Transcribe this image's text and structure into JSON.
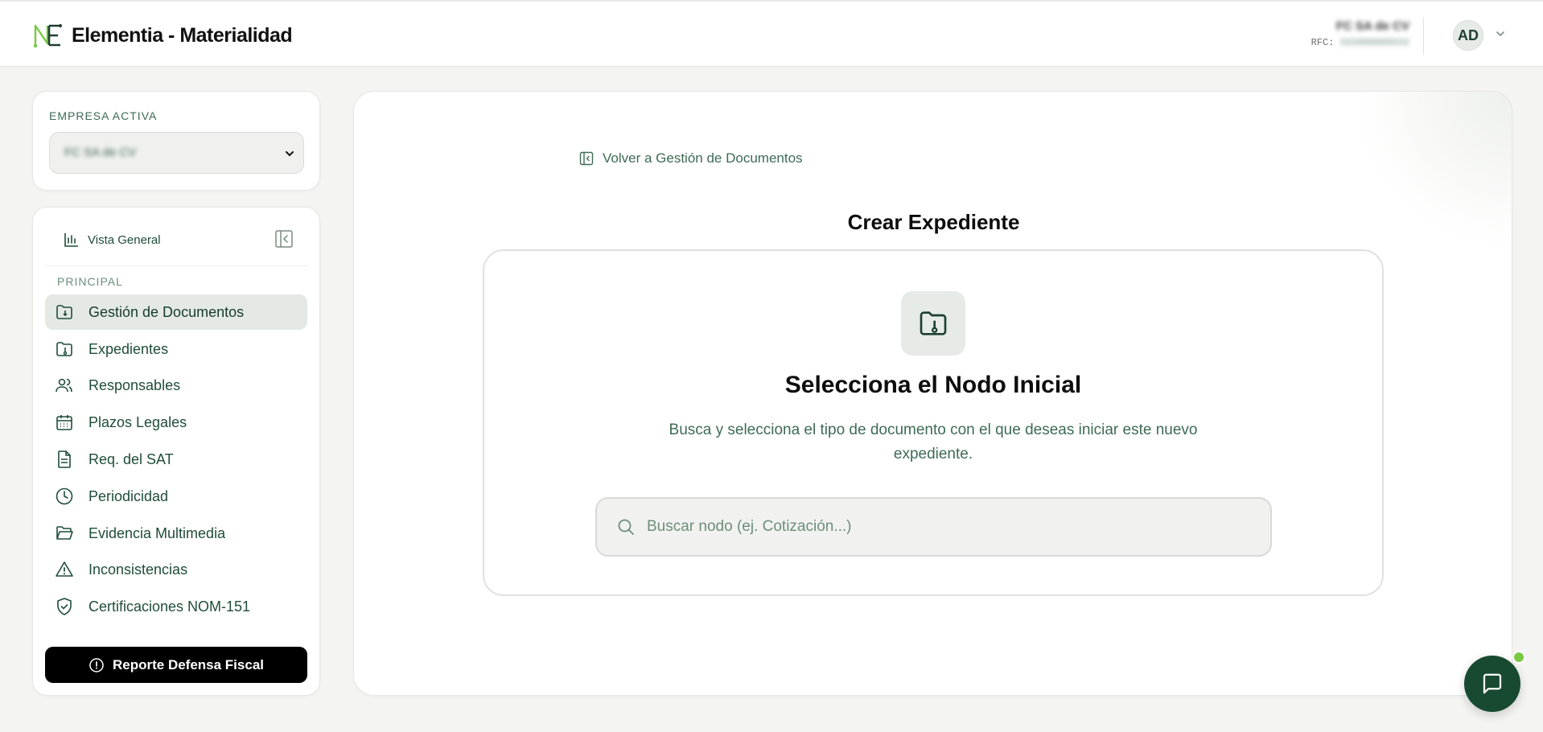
{
  "app": {
    "title": "Elementia - Materialidad"
  },
  "header": {
    "company_name": "FC SA de CV",
    "rfc_label": "RFC:",
    "rfc_value": "XXX000000XXX",
    "avatar_initials": "AD"
  },
  "company_selector": {
    "label": "EMPRESA ACTIVA",
    "selected": "FC SA de CV"
  },
  "sidebar": {
    "overview_label": "Vista General",
    "section_label": "PRINCIPAL",
    "items": [
      {
        "label": "Gestión de Documentos",
        "icon": "folder-upload-icon"
      },
      {
        "label": "Expedientes",
        "icon": "folder-download-icon"
      },
      {
        "label": "Responsables",
        "icon": "users-icon"
      },
      {
        "label": "Plazos Legales",
        "icon": "calendar-icon"
      },
      {
        "label": "Req. del SAT",
        "icon": "document-icon"
      },
      {
        "label": "Periodicidad",
        "icon": "clock-icon"
      },
      {
        "label": "Evidencia Multimedia",
        "icon": "folder-open-icon"
      },
      {
        "label": "Inconsistencias",
        "icon": "warning-icon"
      },
      {
        "label": "Certificaciones NOM-151",
        "icon": "shield-check-icon"
      }
    ],
    "active_index": 0,
    "report_button": "Reporte Defensa Fiscal"
  },
  "main": {
    "back_link": "Volver a Gestión de Documentos",
    "page_title": "Crear Expediente",
    "picker_title": "Selecciona el Nodo Inicial",
    "picker_description": "Busca y selecciona el tipo de documento con el que deseas iniciar este nuevo expediente.",
    "search_placeholder": "Buscar nodo (ej. Cotización...)"
  },
  "colors": {
    "brand_green": "#1f4d3a",
    "accent_green": "#7ac943",
    "chat_fab": "#184a31"
  }
}
